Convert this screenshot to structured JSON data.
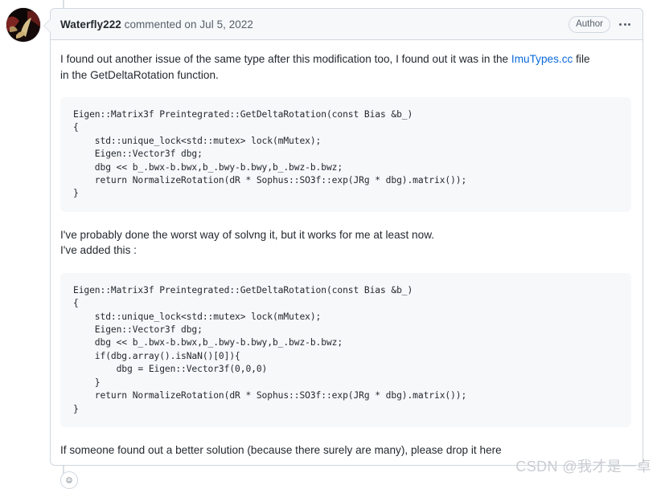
{
  "timeline": {
    "rail_color": "#d8dee4"
  },
  "avatar": {
    "alt": "Waterfly222 avatar"
  },
  "comment": {
    "header": {
      "author": "Waterfly222",
      "action": " commented on ",
      "date": "Jul 5, 2022",
      "author_badge": "Author",
      "menu_label": "⋯"
    },
    "body": {
      "paragraph1_part1": "I found out another issue of the same type after this modification too, I found out it was in the ",
      "paragraph1_link": "ImuTypes.cc",
      "paragraph1_part2": " file in the GetDeltaRotation function.",
      "code1": "Eigen::Matrix3f Preintegrated::GetDeltaRotation(const Bias &b_)\n{\n    std::unique_lock<std::mutex> lock(mMutex);\n    Eigen::Vector3f dbg;\n    dbg << b_.bwx-b.bwx,b_.bwy-b.bwy,b_.bwz-b.bwz;\n    return NormalizeRotation(dR * Sophus::SO3f::exp(JRg * dbg).matrix());\n}",
      "paragraph2": "I've probably done the worst way of solvng it, but it works for me at least now.\nI've added this :",
      "code2": "Eigen::Matrix3f Preintegrated::GetDeltaRotation(const Bias &b_)\n{\n    std::unique_lock<std::mutex> lock(mMutex);\n    Eigen::Vector3f dbg;\n    dbg << b_.bwx-b.bwx,b_.bwy-b.bwy,b_.bwz-b.bwz;\n    if(dbg.array().isNaN()[0]){\n        dbg = Eigen::Vector3f(0,0,0)\n    }\n    return NormalizeRotation(dR * Sophus::SO3f::exp(JRg * dbg).matrix());\n}",
      "paragraph3": "If someone found out a better solution (because there surely are many), please drop it here"
    },
    "reaction": {
      "label": "smiley-face"
    }
  },
  "watermark": {
    "text": "CSDN @我才是一卓"
  },
  "colors": {
    "link": "#0969da",
    "text": "#24292f",
    "muted": "#57606a",
    "border": "#d0d7de",
    "code_bg": "#f6f8fa",
    "header_bg": "#f6f8fa"
  }
}
